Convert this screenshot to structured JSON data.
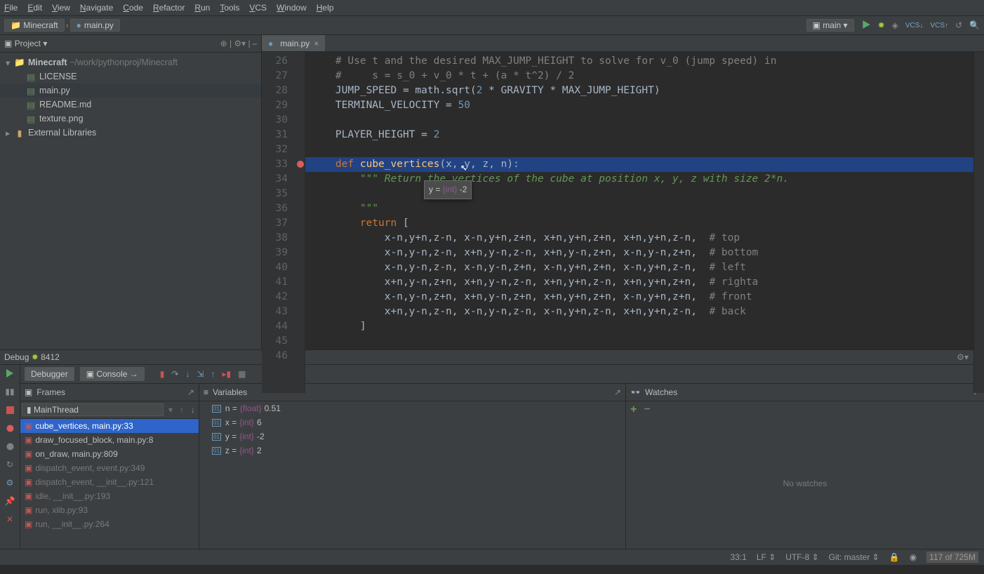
{
  "menu": {
    "items": [
      "File",
      "Edit",
      "View",
      "Navigate",
      "Code",
      "Refactor",
      "Run",
      "Tools",
      "VCS",
      "Window",
      "Help"
    ]
  },
  "breadcrumb": {
    "root": "Minecraft",
    "file": "main.py"
  },
  "runconfig": {
    "name": "main"
  },
  "project": {
    "title": "Project",
    "root": {
      "name": "Minecraft",
      "path": "~/work/pythonproj/Minecraft"
    },
    "files": [
      "LICENSE",
      "main.py",
      "README.md",
      "texture.png"
    ],
    "extlib": "External Libraries"
  },
  "tab": {
    "name": "main.py"
  },
  "code": {
    "start": 26,
    "lines": [
      {
        "n": 26,
        "html": "    <span class='cmt'># Use t and the desired MAX_JUMP_HEIGHT to solve for v_0 (jump speed) in</span>"
      },
      {
        "n": 27,
        "html": "    <span class='cmt'>#     s = s_0 + v_0 * t + (a * t^2) / 2</span>"
      },
      {
        "n": 28,
        "html": "    JUMP_SPEED = math.sqrt(<span class='num'>2</span> * GRAVITY * MAX_JUMP_HEIGHT)"
      },
      {
        "n": 29,
        "html": "    TERMINAL_VELOCITY = <span class='num'>50</span>"
      },
      {
        "n": 30,
        "html": ""
      },
      {
        "n": 31,
        "html": "    PLAYER_HEIGHT = <span class='num'>2</span>"
      },
      {
        "n": 32,
        "html": ""
      },
      {
        "n": 33,
        "hl": true,
        "bp": true,
        "html": "    <span class='kw'>def</span> <span class='fn'>cube_vertices</span>(x, y, z, n):"
      },
      {
        "n": 34,
        "html": "        <span class='str'>\"\"\" Return the vertices of the cube at position x, y, z with size 2*n.</span>"
      },
      {
        "n": 35,
        "html": ""
      },
      {
        "n": 36,
        "html": "        <span class='str'>\"\"\"</span>"
      },
      {
        "n": 37,
        "html": "        <span class='kw'>return</span> ["
      },
      {
        "n": 38,
        "html": "            x-n,y+n,z-n, x-n,y+n,z+n, x+n,y+n,z+n, x+n,y+n,z-n,  <span class='cmt'># top</span>"
      },
      {
        "n": 39,
        "html": "            x-n,y-n,z-n, x+n,y-n,z-n, x+n,y-n,z+n, x-n,y-n,z+n,  <span class='cmt'># bottom</span>"
      },
      {
        "n": 40,
        "html": "            x-n,y-n,z-n, x-n,y-n,z+n, x-n,y+n,z+n, x-n,y+n,z-n,  <span class='cmt'># left</span>"
      },
      {
        "n": 41,
        "html": "            x+n,y-n,z+n, x+n,y-n,z-n, x+n,y+n,z-n, x+n,y+n,z+n,  <span class='cmt'># righta</span>"
      },
      {
        "n": 42,
        "html": "            x-n,y-n,z+n, x+n,y-n,z+n, x+n,y+n,z+n, x-n,y+n,z+n,  <span class='cmt'># front</span>"
      },
      {
        "n": 43,
        "html": "            x+n,y-n,z-n, x-n,y-n,z-n, x-n,y+n,z-n, x+n,y+n,z-n,  <span class='cmt'># back</span>"
      },
      {
        "n": 44,
        "html": "        ]"
      },
      {
        "n": 45,
        "html": ""
      },
      {
        "n": 46,
        "html": ""
      }
    ]
  },
  "tooltip": {
    "var": "y",
    "type": "{int}",
    "val": "-2"
  },
  "debug": {
    "title": "Debug",
    "proc": "8412",
    "tabs": {
      "debugger": "Debugger",
      "console": "Console"
    },
    "frames_title": "Frames",
    "vars_title": "Variables",
    "watches_title": "Watches",
    "thread": "MainThread",
    "frames": [
      {
        "t": "cube_vertices, main.py:33",
        "sel": true
      },
      {
        "t": "draw_focused_block, main.py:8"
      },
      {
        "t": "on_draw, main.py:809"
      },
      {
        "t": "dispatch_event, event.py:349",
        "dim": true
      },
      {
        "t": "dispatch_event, __init__.py:121",
        "dim": true
      },
      {
        "t": "idle, __init__.py:193",
        "dim": true
      },
      {
        "t": "run, xlib.py:93",
        "dim": true
      },
      {
        "t": "run, __init__.py:264",
        "dim": true
      }
    ],
    "vars": [
      {
        "n": "n",
        "t": "{float}",
        "v": "0.51"
      },
      {
        "n": "x",
        "t": "{int}",
        "v": "6"
      },
      {
        "n": "y",
        "t": "{int}",
        "v": "-2"
      },
      {
        "n": "z",
        "t": "{int}",
        "v": "2"
      }
    ],
    "nowatch": "No watches"
  },
  "status": {
    "pos": "33:1",
    "lf": "LF",
    "enc": "UTF-8",
    "git": "Git: master",
    "mem": "117 of 725M"
  }
}
